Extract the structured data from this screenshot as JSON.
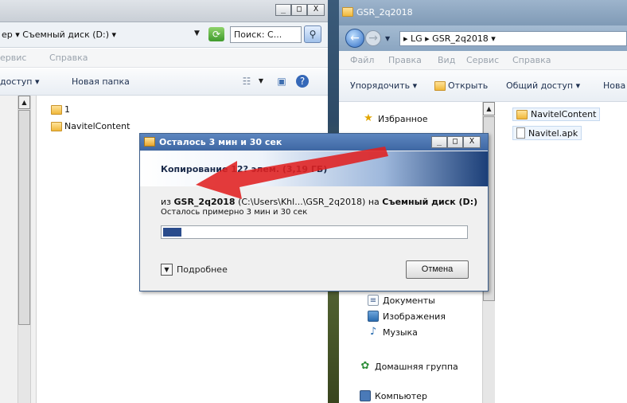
{
  "left_window": {
    "address_crumb": "ер ▾ Съемный диск (D:) ▾",
    "search_placeholder": "Поиск: С...",
    "menu": [
      "ервис",
      "Справка"
    ],
    "toolbar": {
      "share": "доступ ▾",
      "new_folder": "Новая папка"
    },
    "files": [
      "1",
      "NavitelContent"
    ]
  },
  "right_window": {
    "title": "GSR_2q2018",
    "address_path": "▸ LG ▸ GSR_2q2018 ▾",
    "menu": [
      "Файл",
      "Правка",
      "Вид",
      "Сервис",
      "Справка"
    ],
    "toolbar": {
      "organize": "Упорядочить ▾",
      "open": "Открыть",
      "share": "Общий доступ ▾",
      "new": "Нова"
    },
    "nav": {
      "favorites": "Избранное",
      "documents": "Документы",
      "images": "Изображения",
      "music": "Музыка",
      "homegroup": "Домашняя группа",
      "computer": "Компьютер"
    },
    "files": [
      "NavitelContent",
      "Navitel.apk"
    ]
  },
  "dialog": {
    "title": "Осталось 3 мин и 30 сек",
    "header": "Копирование 12? элем. (3,19 ГБ)",
    "from_prefix": "из ",
    "source_name": "GSR_2q2018",
    "source_path": " (C:\\Users\\Khl...\\GSR_2q2018) на ",
    "dest_name": "Съемный диск (D:)",
    "remaining": "Осталось примерно 3 мин и 30 сек",
    "progress": 0.06,
    "more_label": "Подробнее",
    "cancel_label": "Отмена"
  },
  "colors": {
    "arrow": "#e02020",
    "progress_fill": "#2a4c8c",
    "dialog_title": "#4a74b0"
  }
}
